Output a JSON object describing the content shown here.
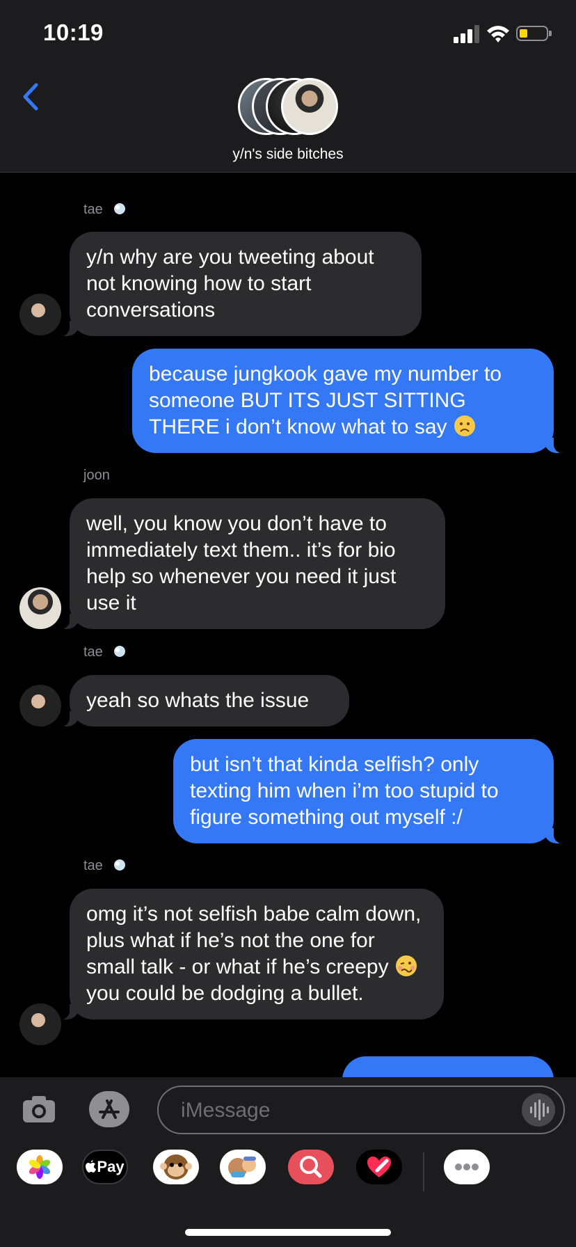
{
  "status": {
    "time": "10:19"
  },
  "header": {
    "group_name": "y/n's side bitches"
  },
  "messages": [
    {
      "sender": "tae",
      "text": "y/n why are you tweeting about not knowing how to start conversations"
    },
    {
      "text": "because jungkook gave my number to someone BUT ITS JUST SITTING THERE i don’t know what to say"
    },
    {
      "sender": "joon",
      "text": "well, you know you don’t have to immediately text them.. it’s for bio help so whenever you need it just use it"
    },
    {
      "sender": "tae",
      "text": "yeah so whats the issue"
    },
    {
      "text": "but isn’t that kinda selfish? only texting him when i’m too stupid to figure something out myself :/"
    },
    {
      "sender": "tae",
      "text_before_emoji": "omg it’s not selfish babe calm down, plus what if he’s not the one for small talk - or what if he’s creepy",
      "text_after_emoji": "you could be dodging a bullet."
    }
  ],
  "input": {
    "placeholder": "iMessage"
  },
  "apps": {
    "pay_label": "Pay"
  },
  "colors": {
    "outgoing": "#3478f6",
    "incoming": "#2c2c2e",
    "background": "#000000",
    "bar": "#1c1c1e"
  }
}
